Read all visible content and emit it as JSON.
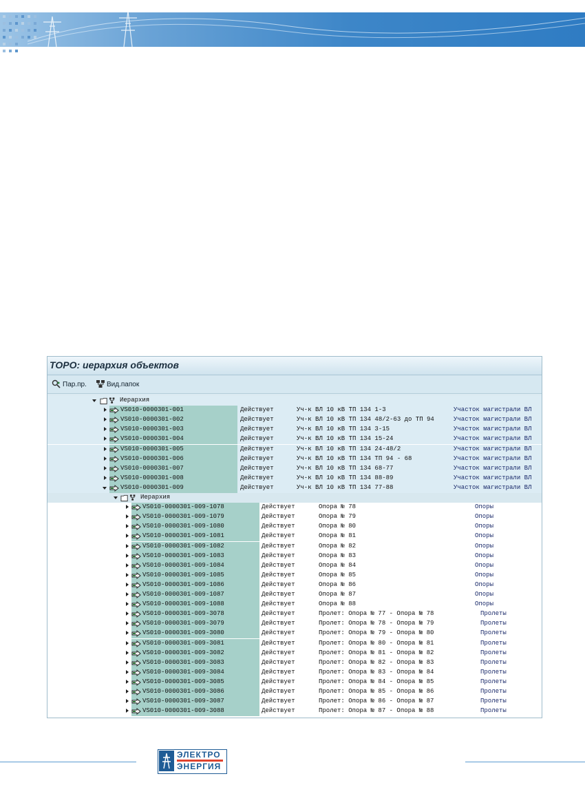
{
  "window": {
    "title": "ТОРО: иерархия объектов"
  },
  "toolbar": {
    "btn1": "Пар.пр.",
    "btn2": "Вид.папок"
  },
  "root": {
    "label": "Иерархия"
  },
  "top_items": [
    {
      "id": "VS010-0000301-001",
      "status": "Действует",
      "desc": "Уч-к ВЛ 10 кВ ТП 134 1-3",
      "cls": "Участок магистрали ВЛ",
      "expanded": false
    },
    {
      "id": "VS010-0000301-002",
      "status": "Действует",
      "desc": "Уч-к ВЛ 10 кВ ТП 134 48/2-63 до ТП 94",
      "cls": "Участок магистрали ВЛ",
      "expanded": false
    },
    {
      "id": "VS010-0000301-003",
      "status": "Действует",
      "desc": "Уч-к ВЛ 10 кВ ТП 134 3-15",
      "cls": "Участок магистрали ВЛ",
      "expanded": false
    },
    {
      "id": "VS010-0000301-004",
      "status": "Действует",
      "desc": "Уч-к ВЛ 10 кВ ТП 134 15-24",
      "cls": "Участок магистрали ВЛ",
      "expanded": false
    },
    {
      "id": "VS010-0000301-005",
      "status": "Действует",
      "desc": "Уч-к ВЛ 10 кВ ТП 134 24-48/2",
      "cls": "Участок магистрали ВЛ",
      "expanded": false
    },
    {
      "id": "VS010-0000301-006",
      "status": "Действует",
      "desc": "Уч-к ВЛ 10 кВ ТП 134 ТП 94 - 68",
      "cls": "Участок магистрали ВЛ",
      "expanded": false
    },
    {
      "id": "VS010-0000301-007",
      "status": "Действует",
      "desc": "Уч-к ВЛ 10 кВ ТП 134 68-77",
      "cls": "Участок магистрали ВЛ",
      "expanded": false
    },
    {
      "id": "VS010-0000301-008",
      "status": "Действует",
      "desc": "Уч-к ВЛ 10 кВ ТП 134 88-89",
      "cls": "Участок магистрали ВЛ",
      "expanded": false
    },
    {
      "id": "VS010-0000301-009",
      "status": "Действует",
      "desc": "Уч-к ВЛ 10 кВ ТП 134 77-88",
      "cls": "Участок магистрали ВЛ",
      "expanded": true
    }
  ],
  "sub_root": {
    "label": "Иерархия"
  },
  "sub_items": [
    {
      "id": "VS010-0000301-009-1078",
      "status": "Действует",
      "desc": "Опора № 78",
      "cls": "Опоры"
    },
    {
      "id": "VS010-0000301-009-1079",
      "status": "Действует",
      "desc": "Опора № 79",
      "cls": "Опоры"
    },
    {
      "id": "VS010-0000301-009-1080",
      "status": "Действует",
      "desc": "Опора № 80",
      "cls": "Опоры"
    },
    {
      "id": "VS010-0000301-009-1081",
      "status": "Действует",
      "desc": "Опора № 81",
      "cls": "Опоры"
    },
    {
      "id": "VS010-0000301-009-1082",
      "status": "Действует",
      "desc": "Опора № 82",
      "cls": "Опоры"
    },
    {
      "id": "VS010-0000301-009-1083",
      "status": "Действует",
      "desc": "Опора № 83",
      "cls": "Опоры"
    },
    {
      "id": "VS010-0000301-009-1084",
      "status": "Действует",
      "desc": "Опора № 84",
      "cls": "Опоры"
    },
    {
      "id": "VS010-0000301-009-1085",
      "status": "Действует",
      "desc": "Опора № 85",
      "cls": "Опоры"
    },
    {
      "id": "VS010-0000301-009-1086",
      "status": "Действует",
      "desc": "Опора № 86",
      "cls": "Опоры"
    },
    {
      "id": "VS010-0000301-009-1087",
      "status": "Действует",
      "desc": "Опора № 87",
      "cls": "Опоры"
    },
    {
      "id": "VS010-0000301-009-1088",
      "status": "Действует",
      "desc": "Опора № 88",
      "cls": "Опоры"
    },
    {
      "id": "VS010-0000301-009-3078",
      "status": "Действует",
      "desc": "Пролет: Опора № 77 - Опора № 78",
      "cls": "Пролеты"
    },
    {
      "id": "VS010-0000301-009-3079",
      "status": "Действует",
      "desc": "Пролет: Опора № 78 - Опора № 79",
      "cls": "Пролеты"
    },
    {
      "id": "VS010-0000301-009-3080",
      "status": "Действует",
      "desc": "Пролет: Опора № 79 - Опора № 80",
      "cls": "Пролеты"
    },
    {
      "id": "VS010-0000301-009-3081",
      "status": "Действует",
      "desc": "Пролет: Опора № 80 - Опора № 81",
      "cls": "Пролеты"
    },
    {
      "id": "VS010-0000301-009-3082",
      "status": "Действует",
      "desc": "Пролет: Опора № 81 - Опора № 82",
      "cls": "Пролеты"
    },
    {
      "id": "VS010-0000301-009-3083",
      "status": "Действует",
      "desc": "Пролет: Опора № 82 - Опора № 83",
      "cls": "Пролеты"
    },
    {
      "id": "VS010-0000301-009-3084",
      "status": "Действует",
      "desc": "Пролет: Опора № 83 - Опора № 84",
      "cls": "Пролеты"
    },
    {
      "id": "VS010-0000301-009-3085",
      "status": "Действует",
      "desc": "Пролет: Опора № 84 - Опора № 85",
      "cls": "Пролеты"
    },
    {
      "id": "VS010-0000301-009-3086",
      "status": "Действует",
      "desc": "Пролет: Опора № 85 - Опора № 86",
      "cls": "Пролеты"
    },
    {
      "id": "VS010-0000301-009-3087",
      "status": "Действует",
      "desc": "Пролет: Опора № 86 - Опора № 87",
      "cls": "Пролеты"
    },
    {
      "id": "VS010-0000301-009-3088",
      "status": "Действует",
      "desc": "Пролет: Опора № 87 - Опора № 88",
      "cls": "Пролеты"
    }
  ],
  "logo": {
    "line1": "ЭЛЕКТРО",
    "line2": "ЭНЕРГИЯ"
  },
  "colors": {
    "id_cell": "#a6d0c9",
    "banner": "#3d86c8",
    "brand": "#1f5c96",
    "accent": "#e0422e"
  }
}
